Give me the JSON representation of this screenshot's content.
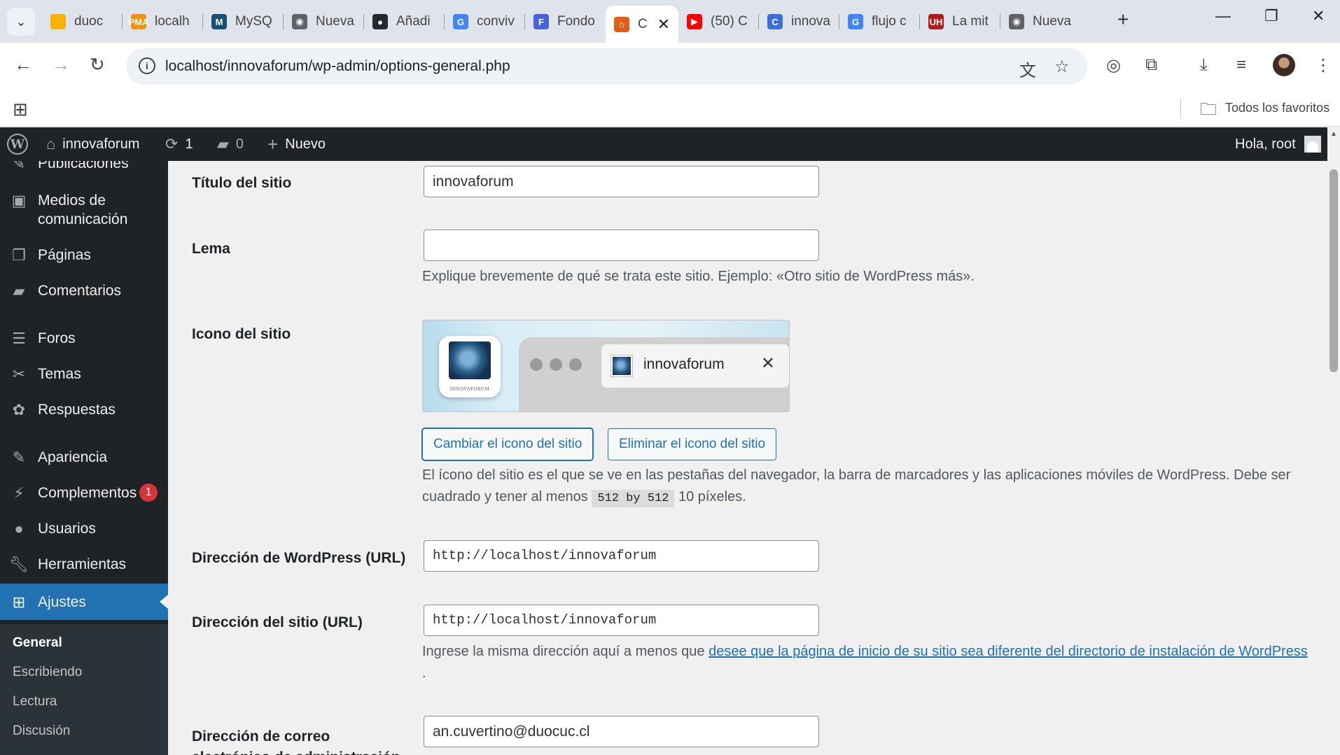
{
  "browser": {
    "tabs": [
      {
        "title": "duoc",
        "fav_color": "#f4b400",
        "fav_glyph": ""
      },
      {
        "title": "localh",
        "fav_color": "#f29111",
        "fav_glyph": "PMA"
      },
      {
        "title": "MySQ",
        "fav_color": "#1b4f72",
        "fav_glyph": "M"
      },
      {
        "title": "Nueva",
        "fav_color": "#5f6368",
        "fav_glyph": "◉"
      },
      {
        "title": "Añadi",
        "fav_color": "#24292f",
        "fav_glyph": "●"
      },
      {
        "title": "conviv",
        "fav_color": "#4285f4",
        "fav_glyph": "G"
      },
      {
        "title": "Fondo",
        "fav_color": "#4a63d8",
        "fav_glyph": "F"
      },
      {
        "title": "C",
        "fav_color": "#e25c1a",
        "fav_glyph": "⌂"
      },
      {
        "title": "(50) C",
        "fav_color": "#ff0000",
        "fav_glyph": "▶"
      },
      {
        "title": "innova",
        "fav_color": "#3b6fd8",
        "fav_glyph": "C"
      },
      {
        "title": "flujo c",
        "fav_color": "#4285f4",
        "fav_glyph": "G"
      },
      {
        "title": "La mit",
        "fav_color": "#b31b1b",
        "fav_glyph": "UH"
      },
      {
        "title": "Nueva",
        "fav_color": "#5f6368",
        "fav_glyph": "◉"
      }
    ],
    "active_tab_index": 7,
    "url": "localhost/innovaforum/wp-admin/options-general.php",
    "bookmarks_label": "Todos los favoritos"
  },
  "adminbar": {
    "site_name": "innovaforum",
    "updates_count": "1",
    "comments_count": "0",
    "new_label": "Nuevo",
    "greeting": "Hola, root"
  },
  "sidebar": {
    "items": [
      {
        "label": "Publicaciones",
        "icon": "pin-icon"
      },
      {
        "label": "Medios de comunicación",
        "icon": "media-icon"
      },
      {
        "label": "Páginas",
        "icon": "pages-icon"
      },
      {
        "label": "Comentarios",
        "icon": "comments-icon"
      },
      {
        "label": "Foros",
        "icon": "forums-icon"
      },
      {
        "label": "Temas",
        "icon": "topics-icon"
      },
      {
        "label": "Respuestas",
        "icon": "replies-icon"
      },
      {
        "label": "Apariencia",
        "icon": "appearance-icon"
      },
      {
        "label": "Complementos",
        "icon": "plugins-icon",
        "badge": "1"
      },
      {
        "label": "Usuarios",
        "icon": "users-icon"
      },
      {
        "label": "Herramientas",
        "icon": "tools-icon"
      },
      {
        "label": "Ajustes",
        "icon": "settings-icon"
      }
    ],
    "submenu": [
      "General",
      "Escribiendo",
      "Lectura",
      "Discusión"
    ]
  },
  "settings": {
    "site_title_label": "Título del sitio",
    "site_title_value": "innovaforum",
    "tagline_label": "Lema",
    "tagline_value": "",
    "tagline_desc": "Explique brevemente de qué se trata este sitio. Ejemplo: «Otro sitio de WordPress más».",
    "site_icon_label": "Icono del sitio",
    "site_icon_preview_name": "innovaforum",
    "site_icon_caption": "INNOVAFORUM",
    "change_icon_button": "Cambiar el icono del sitio",
    "remove_icon_button": "Eliminar el icono del sitio",
    "site_icon_desc_1": "El ícono del sitio es el que se ve en las pestañas del navegador, la barra de marcadores y las aplicaciones móviles de WordPress. Debe ser cuadrado y tener al menos",
    "site_icon_code": "512 by 512",
    "site_icon_desc_2": "10 píxeles.",
    "wp_url_label": "Dirección de WordPress (URL)",
    "wp_url_value": "http://localhost/innovaforum",
    "site_url_label": "Dirección del sitio (URL)",
    "site_url_value": "http://localhost/innovaforum",
    "site_url_desc_1": "Ingrese la misma dirección aquí a menos que",
    "site_url_link": "desee que la página de inicio de su sitio sea diferente del directorio de instalación de WordPress",
    "site_url_desc_2": ".",
    "email_label": "Dirección de correo electrónico de administración",
    "email_value": "an.cuvertino@duocuc.cl"
  }
}
